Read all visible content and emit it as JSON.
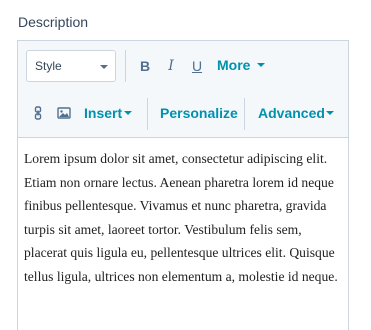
{
  "field": {
    "label": "Description"
  },
  "toolbar": {
    "style_select": {
      "value": "Style",
      "icon": "chevron-down-icon"
    },
    "bold_label": "B",
    "italic_label": "I",
    "underline_label": "U",
    "more_label": "More",
    "link_icon": "link-icon",
    "image_icon": "image-icon",
    "insert_label": "Insert",
    "personalize_label": "Personalize",
    "advanced_label": "Advanced",
    "accent_color": "#0091ae"
  },
  "content": {
    "text": "Lorem ipsum dolor sit amet, consectetur adipiscing elit. Etiam non ornare lectus. Aenean pharetra lorem id neque finibus pellentesque. Vivamus et nunc pharetra, gravida turpis sit amet, laoreet tortor. Vestibulum felis sem, placerat quis ligula eu, pellentesque ultrices elit. Quisque tellus ligula, ultrices non elementum a, molestie id neque."
  }
}
